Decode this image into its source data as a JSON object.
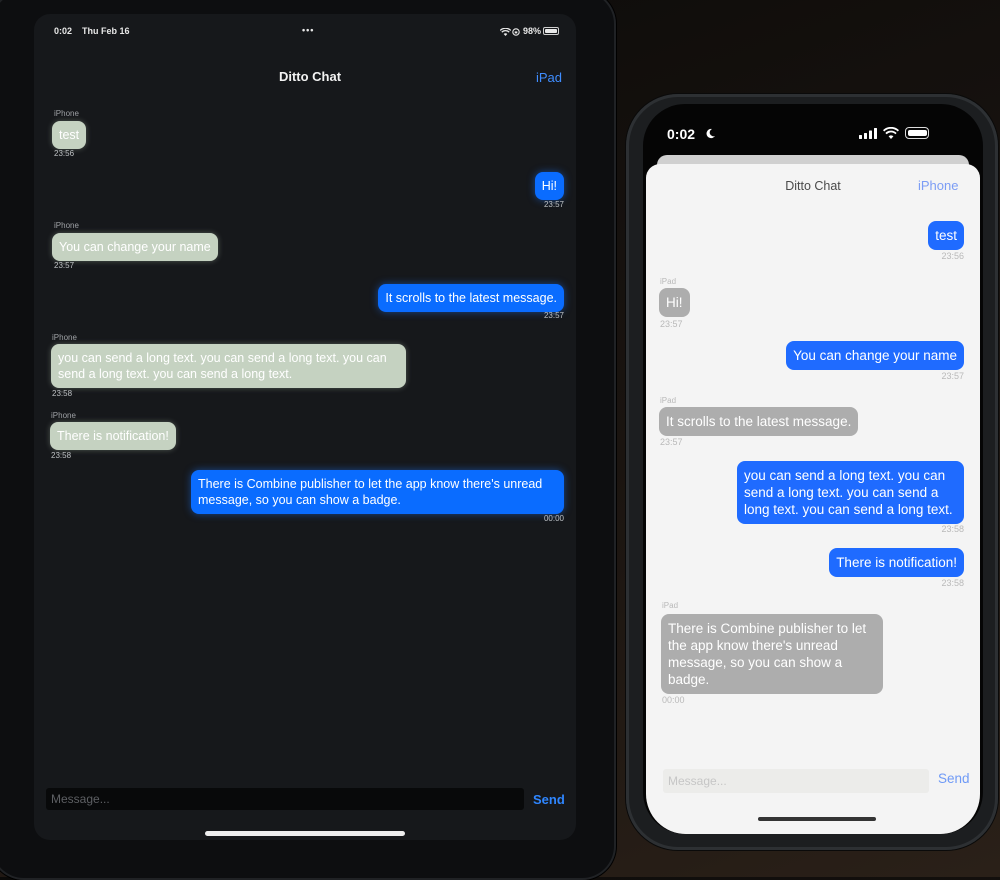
{
  "ipad": {
    "status": {
      "time": "0:02",
      "date": "Thu Feb 16",
      "dots": "•••",
      "battery": "98%"
    },
    "nav": {
      "title": "Ditto Chat",
      "user_name": "iPad"
    },
    "messages": [
      {
        "sender": "iPhone",
        "text": "test",
        "time": "23:56",
        "direction": "in"
      },
      {
        "text": "Hi!",
        "time": "23:57",
        "direction": "out"
      },
      {
        "sender": "iPhone",
        "text": "You can change your name",
        "time": "23:57",
        "direction": "in"
      },
      {
        "text": "It scrolls to the latest message.",
        "time": "23:57",
        "direction": "out"
      },
      {
        "sender": "iPhone",
        "text": "you can send a long text. you can send a long text. you can send a long text. you can send a long text.",
        "time": "23:58",
        "direction": "in"
      },
      {
        "sender": "iPhone",
        "text": "There is notification!",
        "time": "23:58",
        "direction": "in"
      },
      {
        "text": "There is Combine publisher to let the app know there's unread message, so you can show a badge.",
        "time": "00:00",
        "direction": "out"
      }
    ],
    "composer": {
      "placeholder": "Message...",
      "send_label": "Send"
    }
  },
  "iphone": {
    "status": {
      "time": "0:02"
    },
    "nav": {
      "title": "Ditto Chat",
      "user_name": "iPhone"
    },
    "messages": [
      {
        "text": "test",
        "time": "23:56",
        "direction": "out"
      },
      {
        "sender": "iPad",
        "text": "Hi!",
        "time": "23:57",
        "direction": "in"
      },
      {
        "text": "You can change your name",
        "time": "23:57",
        "direction": "out"
      },
      {
        "sender": "iPad",
        "text": "It scrolls to the latest message.",
        "time": "23:57",
        "direction": "in"
      },
      {
        "text": "you can send a long text. you can send a long text. you can send a long text. you can send a long text.",
        "time": "23:58",
        "direction": "out"
      },
      {
        "text": "There is notification!",
        "time": "23:58",
        "direction": "out"
      },
      {
        "sender": "iPad",
        "text": "There is Combine publisher to let the app know there's unread message, so you can show a badge.",
        "time": "00:00",
        "direction": "in"
      }
    ],
    "composer": {
      "placeholder": "Message...",
      "send_label": "Send"
    }
  },
  "colors": {
    "outgoing_bubble": "#0a6cff",
    "incoming_bubble_dark": "#c5d2c1",
    "incoming_bubble_light": "#adadad",
    "accent_link": "#3f8dff"
  },
  "icons": [
    "wifi-icon",
    "battery-icon",
    "moon-icon",
    "signal-icon",
    "lock-icon"
  ]
}
